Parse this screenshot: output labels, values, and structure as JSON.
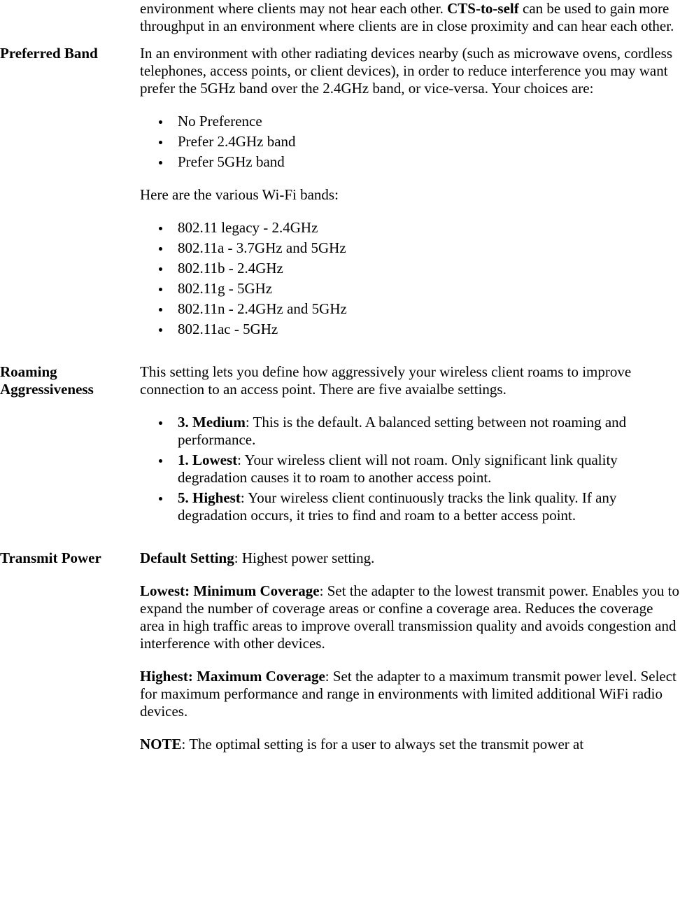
{
  "rows": [
    {
      "label": "",
      "p0_pre": "environment where clients may not hear each other. ",
      "p0_bold": "CTS-to-self",
      "p0_post": " can be used to gain more throughput in an environment where clients are in close proximity and can hear each other."
    },
    {
      "label": "Preferred Band",
      "p0": "In an environment with other radiating devices nearby (such as microwave ovens, cordless telephones, access points, or client devices), in order to reduce interference you may want prefer the 5GHz band over the 2.4GHz band, or vice-versa. Your choices are:",
      "ul1": [
        "No Preference",
        "Prefer 2.4GHz band",
        "Prefer 5GHz band"
      ],
      "p1": "Here are the various Wi-Fi bands:",
      "ul2": [
        "802.11 legacy - 2.4GHz",
        "802.11a - 3.7GHz and 5GHz",
        "802.11b - 2.4GHz",
        "802.11g - 5GHz",
        "802.11n - 2.4GHz and 5GHz",
        "802.11ac - 5GHz"
      ]
    },
    {
      "label": "Roaming Aggressiveness",
      "p0": "This setting lets you define how aggressively your wireless client roams to improve connection to an access point. There are five avaialbe settings.",
      "items": [
        {
          "bold": "3. Medium",
          "text": ": This is the default. A balanced setting between not roaming and performance."
        },
        {
          "bold": "1. Lowest",
          "text": ": Your wireless client will not roam. Only significant link quality degradation causes it to roam to another access point."
        },
        {
          "bold": "5. Highest",
          "text": ": Your wireless client continuously tracks the link quality. If any degradation occurs, it tries to find and roam to a better access point."
        }
      ]
    },
    {
      "label": "Transmit Power",
      "paras": [
        {
          "bold": "Default Setting",
          "text": ": Highest power setting."
        },
        {
          "bold": "Lowest: Minimum Coverage",
          "text": ": Set the adapter to the lowest transmit power. Enables you to expand the number of coverage areas or confine a coverage area. Reduces the coverage area in high traffic areas to improve overall transmission quality and avoids congestion and interference with other devices."
        },
        {
          "bold": "Highest: Maximum Coverage",
          "text": ": Set the adapter to a maximum transmit power level. Select for maximum performance and range in environments with limited additional WiFi radio devices."
        },
        {
          "bold": "NOTE",
          "text": ": The optimal setting is for a user to always set the transmit power at"
        }
      ]
    }
  ]
}
